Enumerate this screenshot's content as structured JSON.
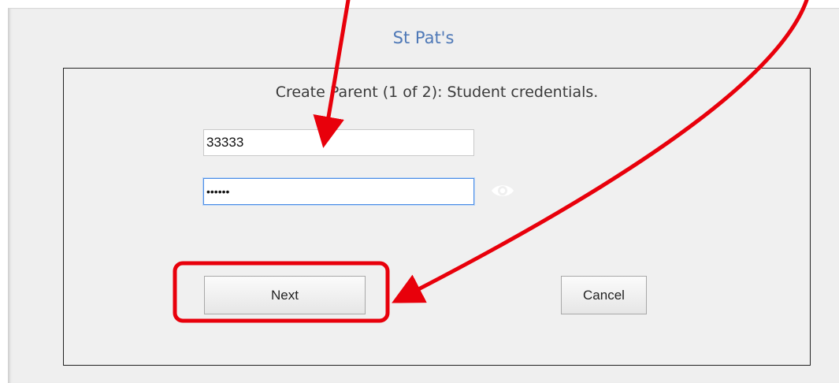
{
  "header": {
    "school_name": "St Pat's"
  },
  "form": {
    "heading": "Create Parent (1 of 2): Student credentials.",
    "student_id_value": "33333",
    "password_value": "••••••",
    "next_label": "Next",
    "cancel_label": "Cancel"
  },
  "icons": {
    "show_password": "eye-icon"
  },
  "colors": {
    "title": "#4f79b7",
    "annotation": "#e8000b",
    "focus_border": "#4f8fe6"
  }
}
